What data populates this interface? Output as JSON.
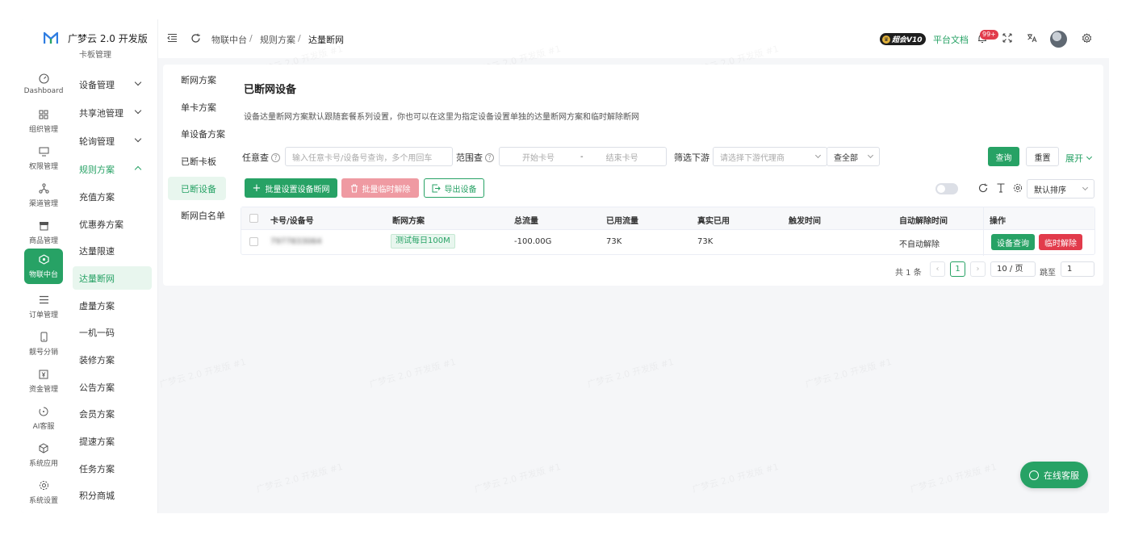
{
  "app": {
    "brand": "广梦云 2.0 开发版",
    "accent": "#27a265",
    "danger": "#e23b4b"
  },
  "rail": [
    {
      "label": "Dashboard",
      "icon": "dashboard-icon"
    },
    {
      "label": "组织管理",
      "icon": "organization-icon"
    },
    {
      "label": "权限管理",
      "icon": "permission-icon"
    },
    {
      "label": "渠道管理",
      "icon": "channel-icon"
    },
    {
      "label": "商品管理",
      "icon": "product-icon"
    },
    {
      "label": "物联中台",
      "icon": "iot-icon",
      "active": true
    },
    {
      "label": "订单管理",
      "icon": "order-icon"
    },
    {
      "label": "靓号分销",
      "icon": "phone-icon"
    },
    {
      "label": "资金管理",
      "icon": "finance-icon"
    },
    {
      "label": "AI客服",
      "icon": "ai-service-icon"
    },
    {
      "label": "系统应用",
      "icon": "system-app-icon"
    },
    {
      "label": "系统设置",
      "icon": "settings-icon"
    }
  ],
  "menu": {
    "cut_item": "卡板管理",
    "items": [
      {
        "label": "设备管理",
        "has_children": true
      },
      {
        "label": "共享池管理",
        "has_children": true
      },
      {
        "label": "轮询管理",
        "has_children": true
      },
      {
        "label": "规则方案",
        "has_children": true,
        "open": true
      },
      {
        "label": "充值方案"
      },
      {
        "label": "优惠券方案"
      },
      {
        "label": "达量限速"
      },
      {
        "label": "达量断网",
        "selected": true
      },
      {
        "label": "虚量方案"
      },
      {
        "label": "一机一码"
      },
      {
        "label": "装修方案"
      },
      {
        "label": "公告方案"
      },
      {
        "label": "会员方案"
      },
      {
        "label": "提速方案"
      },
      {
        "label": "任务方案"
      },
      {
        "label": "积分商城"
      }
    ]
  },
  "header": {
    "breadcrumb": [
      "物联中台",
      "规则方案",
      "达量断网"
    ],
    "vip_label": "超会V10",
    "docs_label": "平台文档",
    "notification_count": "99+"
  },
  "subnav": [
    {
      "label": "断网方案"
    },
    {
      "label": "单卡方案"
    },
    {
      "label": "单设备方案"
    },
    {
      "label": "已断卡板"
    },
    {
      "label": "已断设备",
      "selected": true
    },
    {
      "label": "断网白名单"
    }
  ],
  "page": {
    "title": "已断网设备",
    "description": "设备达量断网方案默认跟随套餐系列设置，你也可以在这里为指定设备设置单独的达量断网方案和临时解除断网"
  },
  "filters": {
    "any_label": "任意查",
    "any_placeholder": "输入任意卡号/设备号查询，多个用回车",
    "range_label": "范围查",
    "range_start_placeholder": "开始卡号",
    "range_sep": "-",
    "range_end_placeholder": "结束卡号",
    "downstream_label": "筛选下游",
    "downstream_placeholder": "请选择下游代理商",
    "scope_value": "查全部",
    "search_label": "查询",
    "reset_label": "重置",
    "expand_label": "展开"
  },
  "actions": {
    "batch_set_label": "批量设置设备断网",
    "batch_release_label": "批量临时解除",
    "export_label": "导出设备",
    "sort_value": "默认排序"
  },
  "table": {
    "columns": [
      "卡号/设备号",
      "断网方案",
      "总流量",
      "已用流量",
      "真实已用",
      "触发时间",
      "自动解除时间",
      "操作"
    ],
    "rows": [
      {
        "device_no": "7977833064",
        "plan": "测试每日100M",
        "total": "-100.00G",
        "used": "73K",
        "real_used": "73K",
        "trigger_time": "",
        "auto_release": "不自动解除",
        "query_label": "设备查询",
        "release_label": "临时解除"
      }
    ]
  },
  "pagination": {
    "total_text": "共 1 条",
    "current_page": "1",
    "page_size": "10 / 页",
    "jump_label": "跳至",
    "jump_value": "1"
  },
  "chat": {
    "label": "在线客服"
  },
  "watermark": "广梦云 2.0 开发版 #1"
}
